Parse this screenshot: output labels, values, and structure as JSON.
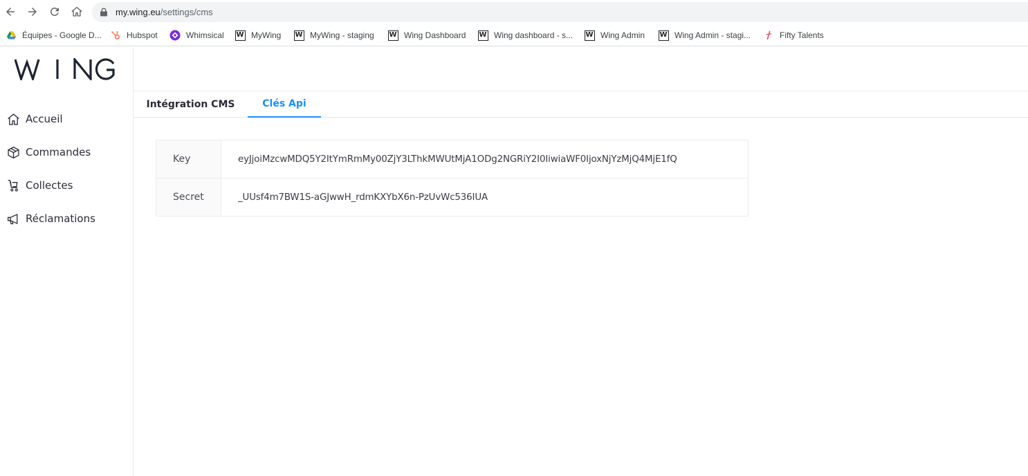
{
  "browser": {
    "url_host": "my.wing.eu",
    "url_path": "/settings/cms",
    "bookmarks": [
      {
        "label": "Équipes - Google D...",
        "icon": "google-drive-icon"
      },
      {
        "label": "Hubspot",
        "icon": "hubspot-icon"
      },
      {
        "label": "Whimsical",
        "icon": "whimsical-icon"
      },
      {
        "label": "MyWing",
        "icon": "wing-w-icon"
      },
      {
        "label": "MyWing - staging",
        "icon": "wing-w-icon"
      },
      {
        "label": "Wing Dashboard",
        "icon": "wing-w-icon"
      },
      {
        "label": "Wing dashboard - s...",
        "icon": "wing-w-icon"
      },
      {
        "label": "Wing Admin",
        "icon": "wing-w-icon"
      },
      {
        "label": "Wing Admin - stagi...",
        "icon": "wing-w-icon"
      },
      {
        "label": "Fifty Talents",
        "icon": "fifty-talents-icon"
      }
    ]
  },
  "app": {
    "logo": "WING",
    "sidebar": {
      "items": [
        {
          "label": "Accueil",
          "icon": "home-icon"
        },
        {
          "label": "Commandes",
          "icon": "package-icon"
        },
        {
          "label": "Collectes",
          "icon": "cart-icon"
        },
        {
          "label": "Réclamations",
          "icon": "megaphone-icon"
        }
      ]
    },
    "tabs": [
      {
        "label": "Intégration CMS",
        "active": false
      },
      {
        "label": "Clés Api",
        "active": true
      }
    ],
    "api_keys": {
      "rows": [
        {
          "label": "Key",
          "value": "eyJjoiMzcwMDQ5Y2ItYmRmMy00ZjY3LThkMWUtMjA1ODg2NGRiY2I0IiwiaWF0IjoxNjYzMjQ4MjE1fQ"
        },
        {
          "label": "Secret",
          "value": "_UUsf4m7BW1S-aGJwwH_rdmKXYbX6n-PzUvWc536IUA"
        }
      ]
    },
    "colors": {
      "accent": "#1890ff",
      "text": "#2b2b38"
    }
  }
}
